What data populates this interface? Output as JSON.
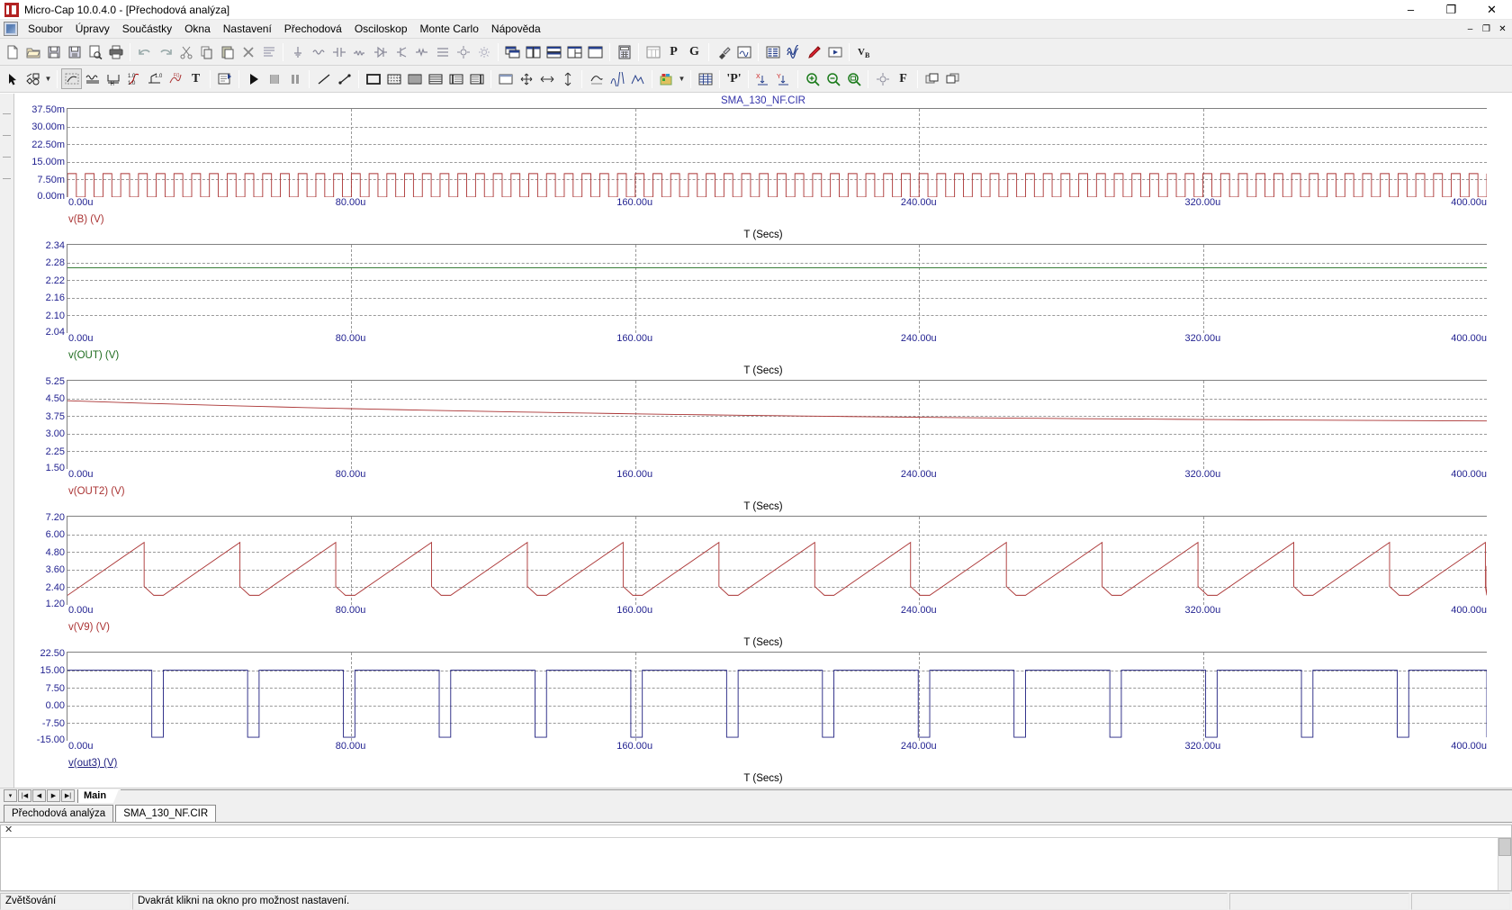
{
  "window": {
    "title": "Micro-Cap 10.0.4.0 - [Přechodová analýza]",
    "app_icon": "microcap-icon",
    "minimize": "–",
    "maximize": "❐",
    "close": "✕",
    "mdi_restore": "❐",
    "mdi_minimize": "–",
    "mdi_close": "✕"
  },
  "menu": {
    "items": [
      {
        "label": "Soubor",
        "name": "menu-soubor"
      },
      {
        "label": "Úpravy",
        "name": "menu-upravy"
      },
      {
        "label": "Součástky",
        "name": "menu-soucastky"
      },
      {
        "label": "Okna",
        "name": "menu-okna"
      },
      {
        "label": "Nastavení",
        "name": "menu-nastaveni"
      },
      {
        "label": "Přechodová",
        "name": "menu-prechodova"
      },
      {
        "label": "Osciloskop",
        "name": "menu-osciloskop"
      },
      {
        "label": "Monte Carlo",
        "name": "menu-monte-carlo"
      },
      {
        "label": "Nápověda",
        "name": "menu-napoveda"
      }
    ]
  },
  "toolbar_labels": {
    "p_button": "P",
    "g_button": "G",
    "vb_button": "V",
    "vb_sub": "B",
    "text_tool": "T",
    "f_button": "F",
    "p_quote": "'P'",
    "x_scale": "X",
    "y_scale": "Y"
  },
  "plot": {
    "title": "SMA_130_NF.CIR",
    "x_axis_label": "T (Secs)",
    "x_ticks": [
      "0.00u",
      "80.00u",
      "160.00u",
      "240.00u",
      "320.00u",
      "400.00u"
    ],
    "colors": {
      "trace_red": "#aa3333",
      "trace_green": "#1d6b1d",
      "trace_navy": "#202080",
      "axis_text": "#1f1f8f",
      "title": "#3333aa",
      "grid": "#999999"
    }
  },
  "chart_data": [
    {
      "type": "line",
      "title": "SMA_130_NF.CIR",
      "name": "v(B) (V)",
      "trace_label": "v(B) (V)",
      "color": "#aa3333",
      "xlabel": "T (Secs)",
      "ylabel": "v(B) (V)",
      "x_ticks": [
        "0.00u",
        "80.00u",
        "160.00u",
        "240.00u",
        "320.00u",
        "400.00u"
      ],
      "y_ticks": [
        "37.50m",
        "30.00m",
        "22.50m",
        "15.00m",
        "7.50m",
        "0.00m"
      ],
      "xlim": [
        0,
        400
      ],
      "ylim": [
        0,
        37.5
      ],
      "waveform": "square",
      "high_value": 10.0,
      "low_value": 0.0,
      "period_us": 5.0,
      "duty": 0.5,
      "grid": true
    },
    {
      "type": "line",
      "name": "v(OUT) (V)",
      "trace_label": "v(OUT) (V)",
      "color": "#1d6b1d",
      "xlabel": "T (Secs)",
      "ylabel": "v(OUT) (V)",
      "x_ticks": [
        "0.00u",
        "80.00u",
        "160.00u",
        "240.00u",
        "320.00u",
        "400.00u"
      ],
      "y_ticks": [
        "2.34",
        "2.28",
        "2.22",
        "2.16",
        "2.10",
        "2.04"
      ],
      "xlim": [
        0,
        400
      ],
      "ylim": [
        2.04,
        2.34
      ],
      "waveform": "constant",
      "constant_value": 2.262,
      "grid": true
    },
    {
      "type": "line",
      "name": "v(OUT2) (V)",
      "trace_label": "v(OUT2) (V)",
      "color": "#aa3333",
      "xlabel": "T (Secs)",
      "ylabel": "v(OUT2) (V)",
      "x_ticks": [
        "0.00u",
        "80.00u",
        "160.00u",
        "240.00u",
        "320.00u",
        "400.00u"
      ],
      "y_ticks": [
        "5.25",
        "4.50",
        "3.75",
        "3.00",
        "2.25",
        "1.50"
      ],
      "xlim": [
        0,
        400
      ],
      "ylim": [
        1.5,
        5.25
      ],
      "waveform": "decay",
      "start_value": 4.4,
      "end_value": 3.42,
      "grid": true
    },
    {
      "type": "line",
      "name": "v(V9) (V)",
      "trace_label": "v(V9) (V)",
      "color": "#aa3333",
      "xlabel": "T (Secs)",
      "ylabel": "v(V9) (V)",
      "x_ticks": [
        "0.00u",
        "80.00u",
        "160.00u",
        "240.00u",
        "320.00u",
        "400.00u"
      ],
      "y_ticks": [
        "7.20",
        "6.00",
        "4.80",
        "3.60",
        "2.40",
        "1.20"
      ],
      "xlim": [
        0,
        400
      ],
      "ylim": [
        1.2,
        7.2
      ],
      "waveform": "sawtooth",
      "peak_value": 5.45,
      "trough_value": 1.85,
      "period_us": 27.0,
      "grid": true
    },
    {
      "type": "line",
      "name": "v(out3) (V)",
      "trace_label": "v(out3) (V)",
      "color": "#202080",
      "xlabel": "T (Secs)",
      "ylabel": "v(out3) (V)",
      "x_ticks": [
        "0.00u",
        "80.00u",
        "160.00u",
        "240.00u",
        "320.00u",
        "400.00u"
      ],
      "y_ticks": [
        "22.50",
        "15.00",
        "7.50",
        "0.00",
        "-7.50",
        "-15.00"
      ],
      "xlim": [
        0,
        400
      ],
      "ylim": [
        -15,
        22.5
      ],
      "waveform": "pulse",
      "high_value": 15.0,
      "low_value": -13.5,
      "period_us": 27.0,
      "duty": 0.88,
      "grid": true
    }
  ],
  "sheetbar": {
    "dropdown": "▾",
    "first": "|◀",
    "prev": "◀",
    "next": "▶",
    "last": "▶|",
    "tab_label": "Main"
  },
  "window_tabs": [
    {
      "label": "Přechodová analýza",
      "active": false
    },
    {
      "label": "SMA_130_NF.CIR",
      "active": true
    }
  ],
  "output_pane": {
    "close_label": "✕",
    "text": ""
  },
  "statusbar": {
    "mode": "Zvětšování",
    "hint": "Dvakrát klikni na okno pro možnost nastavení.",
    "cell3": "",
    "cell4": ""
  }
}
